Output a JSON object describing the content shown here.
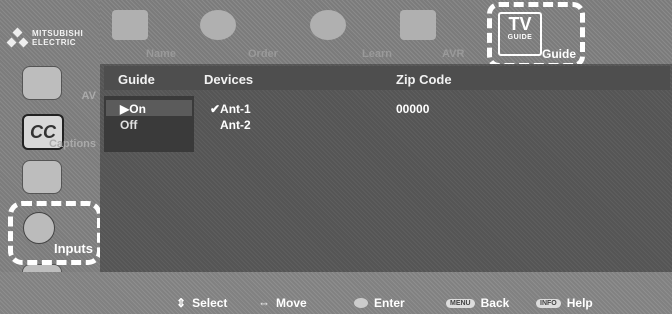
{
  "brand": {
    "line1": "MITSUBISHI",
    "line2": "ELECTRIC"
  },
  "sidebar": {
    "items": [
      {
        "label": "AV"
      },
      {
        "label": "Captions"
      },
      {
        "label": "Inputs"
      }
    ],
    "selected_label": "Inputs",
    "cc_glyph": "CC"
  },
  "tabs": [
    {
      "label": "Name"
    },
    {
      "label": "Order"
    },
    {
      "label": "Learn"
    },
    {
      "label": "AVR"
    },
    {
      "label": "Guide"
    }
  ],
  "tvguide": {
    "big": "TV",
    "small": "GUIDE"
  },
  "table": {
    "headers": {
      "guide": "Guide",
      "devices": "Devices",
      "zip": "Zip Code"
    },
    "guide_options": [
      {
        "label": "▶On",
        "selected": true
      },
      {
        "label": "Off",
        "selected": false
      }
    ],
    "devices": [
      {
        "label": "✔Ant-1"
      },
      {
        "label": "Ant-2"
      }
    ],
    "zip_value": "00000"
  },
  "hints": [
    {
      "key": "⇕",
      "label": "Select"
    },
    {
      "key": "⇔",
      "label": "Move"
    },
    {
      "key": "",
      "label": "Enter"
    },
    {
      "key": "MENU",
      "label": "Back"
    },
    {
      "key": "INFO",
      "label": "Help"
    }
  ]
}
